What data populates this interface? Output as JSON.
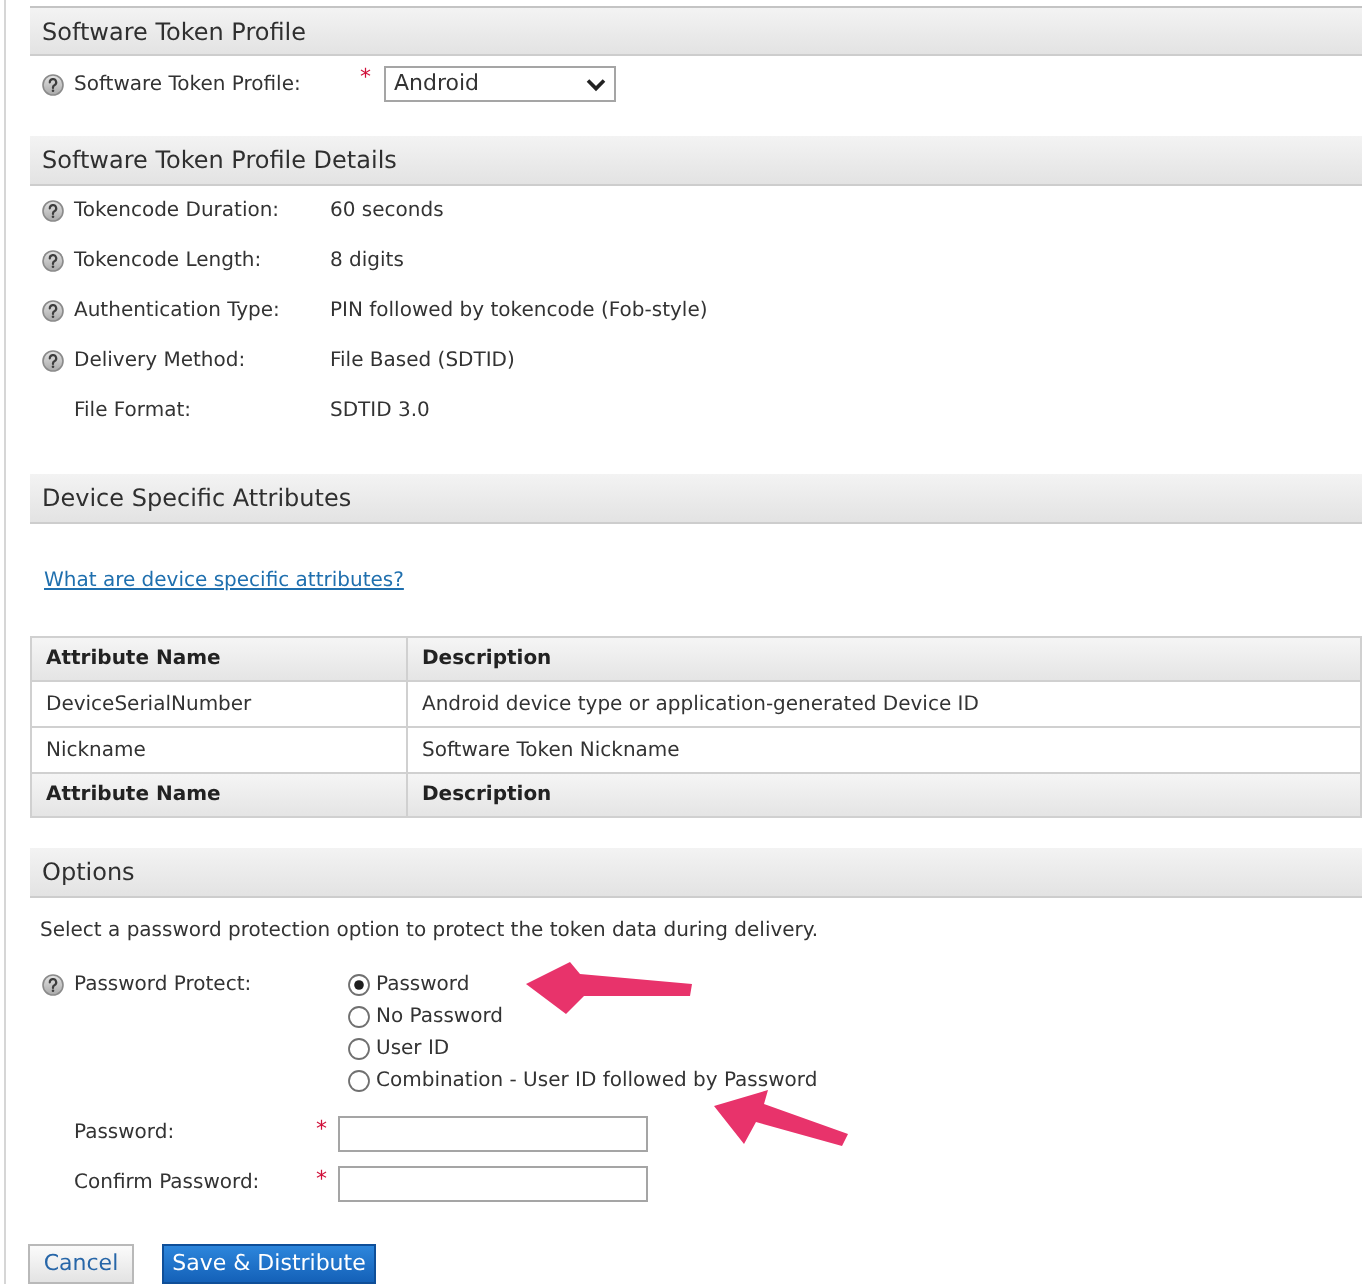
{
  "profile_section": {
    "title": "Software Token Profile",
    "field": {
      "label": "Software Token Profile:",
      "help": true,
      "required_mark": "*",
      "value": "Android"
    }
  },
  "details_section": {
    "title": "Software Token Profile Details",
    "rows": [
      {
        "label": "Tokencode Duration:",
        "value": "60 seconds",
        "help": true
      },
      {
        "label": "Tokencode Length:",
        "value": "8 digits",
        "help": true
      },
      {
        "label": "Authentication Type:",
        "value": "PIN followed by tokencode (Fob-style)",
        "help": true
      },
      {
        "label": "Delivery Method:",
        "value": "File Based (SDTID)",
        "help": true
      },
      {
        "label": "File Format:",
        "value": "SDTID 3.0",
        "help": false
      }
    ]
  },
  "attributes_section": {
    "title": "Device Specific Attributes",
    "link": "What are device specific attributes?",
    "table": {
      "columns": [
        "Attribute Name",
        "Description"
      ],
      "rows": [
        [
          "DeviceSerialNumber",
          "Android device type or application-generated Device ID"
        ],
        [
          "Nickname",
          "Software Token Nickname"
        ]
      ],
      "footer": [
        "Attribute Name",
        "Description"
      ]
    }
  },
  "options_section": {
    "title": "Options",
    "description": "Select a password protection option to protect the token data during delivery.",
    "password_protect": {
      "label": "Password Protect:",
      "help": true,
      "options": [
        {
          "label": "Password",
          "selected": true
        },
        {
          "label": "No Password",
          "selected": false
        },
        {
          "label": "User ID",
          "selected": false
        },
        {
          "label": "Combination - User ID followed by Password",
          "selected": false
        }
      ]
    },
    "fields": [
      {
        "label": "Password:",
        "required_mark": "*"
      },
      {
        "label": "Confirm Password:",
        "required_mark": "*"
      }
    ]
  },
  "buttons": [
    {
      "label": "Cancel",
      "kind": "secondary"
    },
    {
      "label": "Save & Distribute",
      "kind": "primary"
    }
  ]
}
